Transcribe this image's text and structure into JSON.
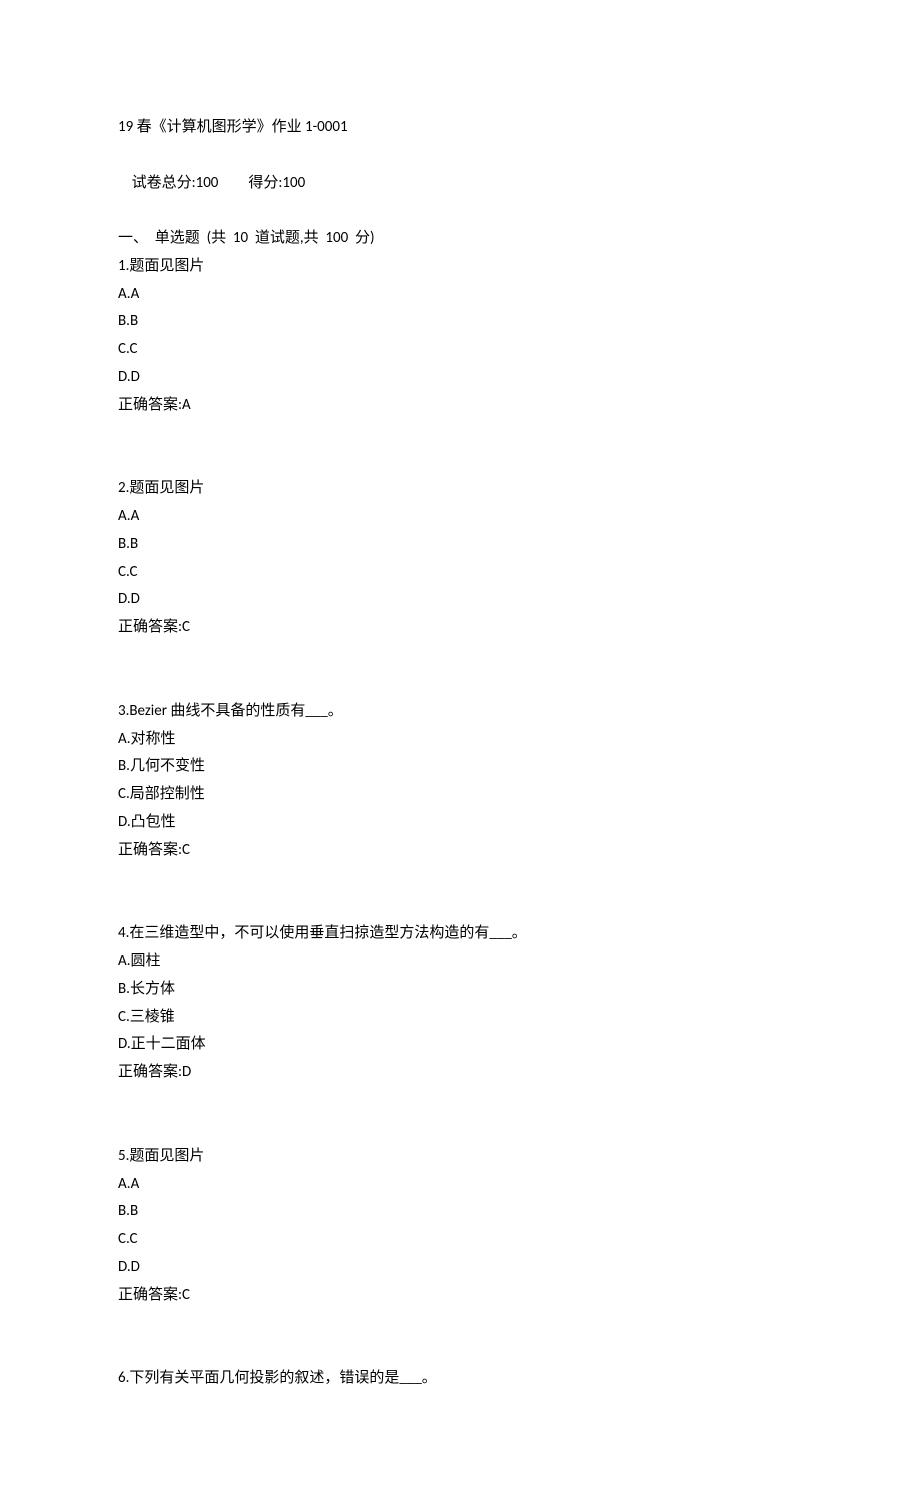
{
  "header": {
    "title": "19 春《计算机图形学》作业 1-0001",
    "score_line_prefix": "试卷总分:",
    "total_score": "100",
    "score_line_mid": "得分:",
    "obtained_score": "100",
    "section_title": "一、  单选题  (共  10  道试题,共  100  分)"
  },
  "questions": [
    {
      "num": "1.",
      "stem": "题面见图片",
      "options": [
        "A.A",
        "B.B",
        "C.C",
        "D.D"
      ],
      "answer_label": "正确答案:",
      "answer": "A"
    },
    {
      "num": "2.",
      "stem": "题面见图片",
      "options": [
        "A.A",
        "B.B",
        "C.C",
        "D.D"
      ],
      "answer_label": "正确答案:",
      "answer": "C"
    },
    {
      "num": "3.",
      "stem": "Bezier 曲线不具备的性质有___。",
      "options": [
        "A.对称性",
        "B.几何不变性",
        "C.局部控制性",
        "D.凸包性"
      ],
      "answer_label": "正确答案:",
      "answer": "C"
    },
    {
      "num": "4.",
      "stem": "在三维造型中，不可以使用垂直扫掠造型方法构造的有___。",
      "options": [
        "A.圆柱",
        "B.长方体",
        "C.三棱锥",
        "D.正十二面体"
      ],
      "answer_label": "正确答案:",
      "answer": "D"
    },
    {
      "num": "5.",
      "stem": "题面见图片",
      "options": [
        "A.A",
        "B.B",
        "C.C",
        "D.D"
      ],
      "answer_label": "正确答案:",
      "answer": "C"
    },
    {
      "num": "6.",
      "stem": "下列有关平面几何投影的叙述，错误的是___。",
      "options": [],
      "answer_label": "",
      "answer": ""
    }
  ]
}
